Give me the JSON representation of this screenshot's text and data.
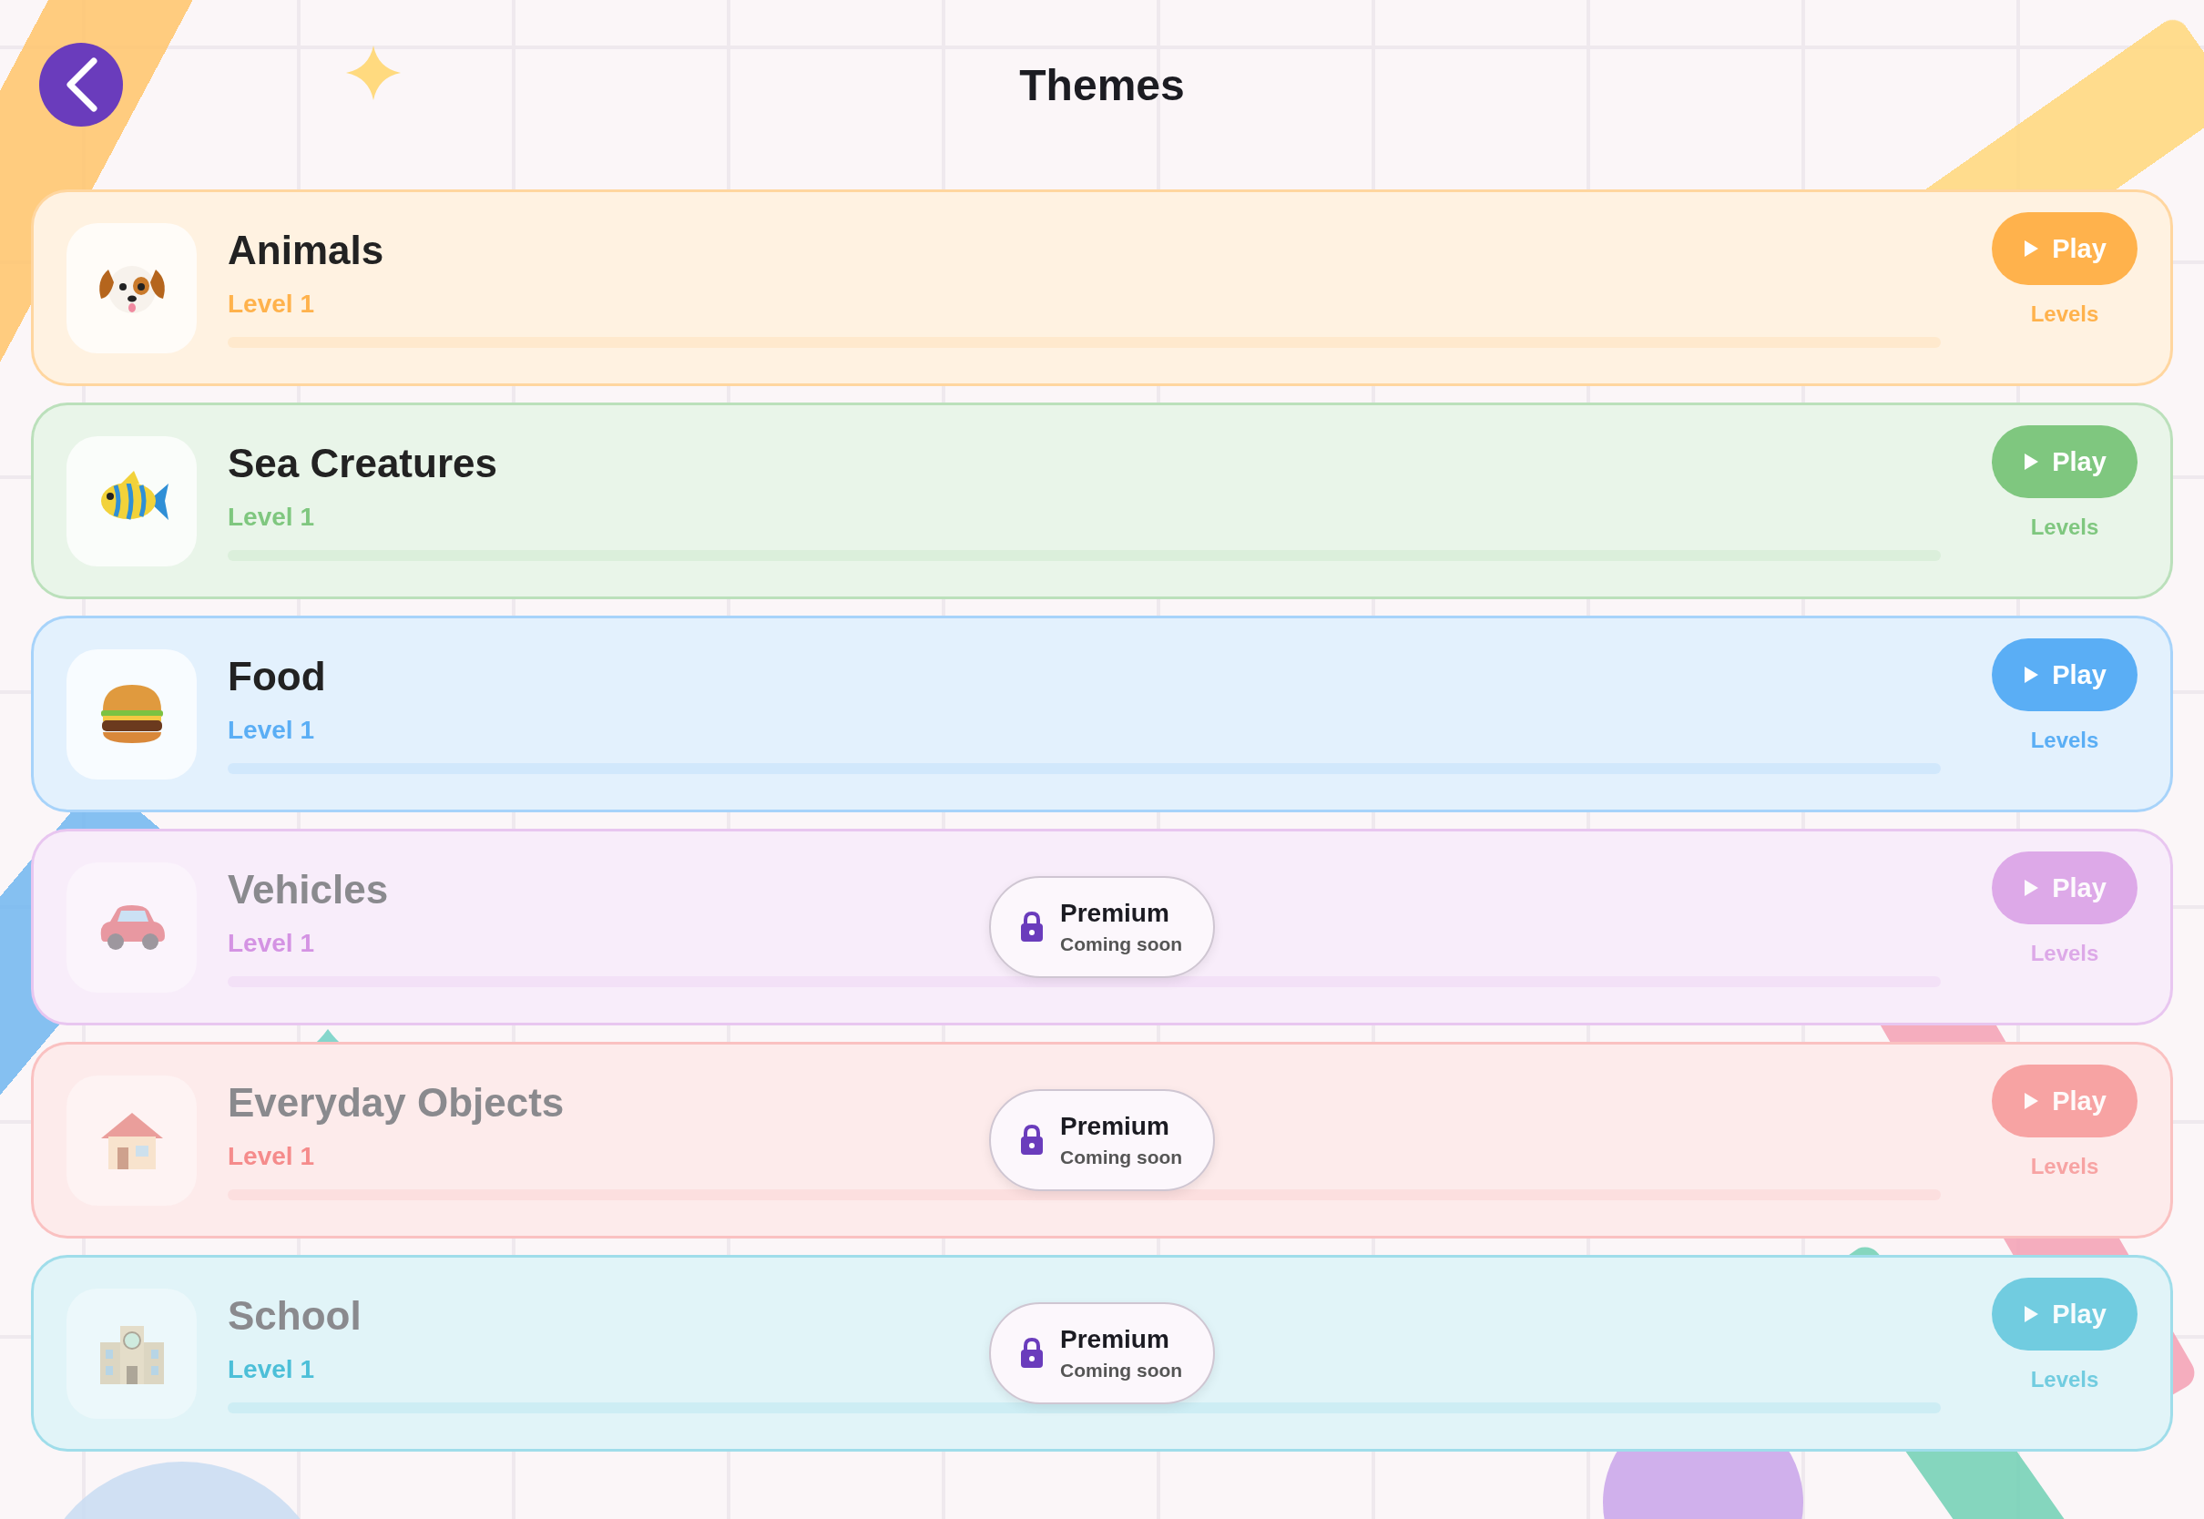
{
  "header": {
    "title": "Themes"
  },
  "themes": [
    {
      "name": "Animals",
      "level_label": "Level 1",
      "color": "#ffb24c",
      "locked": false,
      "play": "Play",
      "levels": "Levels"
    },
    {
      "name": "Sea Creatures",
      "level_label": "Level 1",
      "color": "#7fc77f",
      "locked": false,
      "play": "Play",
      "levels": "Levels"
    },
    {
      "name": "Food",
      "level_label": "Level 1",
      "color": "#5aaef5",
      "locked": false,
      "play": "Play",
      "levels": "Levels"
    },
    {
      "name": "Vehicles",
      "level_label": "Level 1",
      "color": "#d493e3",
      "locked": true,
      "badge_title": "Premium",
      "badge_subtitle": "Coming soon",
      "play": "Play",
      "levels": "Levels"
    },
    {
      "name": "Everyday Objects",
      "level_label": "Level 1",
      "color": "#f58b8b",
      "locked": true,
      "badge_title": "Premium",
      "badge_subtitle": "Coming soon",
      "play": "Play",
      "levels": "Levels"
    },
    {
      "name": "School",
      "level_label": "Level 1",
      "color": "#4cbfd8",
      "locked": true,
      "badge_title": "Premium",
      "badge_subtitle": "Coming soon",
      "play": "Play",
      "levels": "Levels"
    }
  ]
}
